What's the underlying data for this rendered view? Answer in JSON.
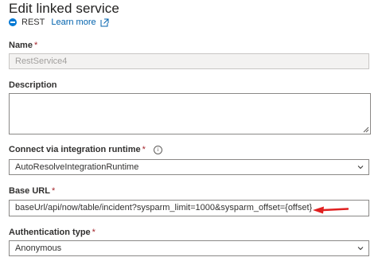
{
  "page": {
    "title": "Edit linked service"
  },
  "service": {
    "type_label": "REST",
    "learn_more": "Learn more"
  },
  "fields": {
    "name": {
      "label": "Name",
      "required_mark": "*",
      "value": "RestService4"
    },
    "description": {
      "label": "Description",
      "value": ""
    },
    "integration_runtime": {
      "label": "Connect via integration runtime",
      "required_mark": "*",
      "info_glyph": "i",
      "value": "AutoResolveIntegrationRuntime"
    },
    "base_url": {
      "label": "Base URL",
      "required_mark": "*",
      "value": "baseUrl/api/now/table/incident?sysparm_limit=1000&sysparm_offset={offset}"
    },
    "authentication_type": {
      "label": "Authentication type",
      "required_mark": "*",
      "value": "Anonymous"
    }
  },
  "icons": {
    "service": "rest-service-icon",
    "external_link": "external-link-icon",
    "info": "info-icon",
    "dropdown": "chevron-down-icon",
    "annotation": "red-arrow-icon"
  },
  "colors": {
    "accent": "#0078d4",
    "link": "#0062ad",
    "required": "#a4262c",
    "annotation_arrow": "#e02020"
  }
}
